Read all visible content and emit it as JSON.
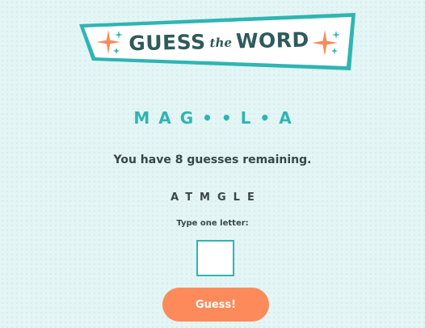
{
  "logo": {
    "word1": "GUESS",
    "word2": "the",
    "word3": "WORD"
  },
  "puzzle": {
    "display": "MAG••L•A"
  },
  "status": {
    "remaining_text": "You have 8 guesses remaining."
  },
  "guessed_letters": {
    "display": "ATMGLE"
  },
  "input": {
    "prompt": "Type one letter:",
    "value": "",
    "placeholder": ""
  },
  "guess_button": {
    "label": "Guess!"
  },
  "colors": {
    "background": "#e3f5f4",
    "accent_teal": "#2fb5b3",
    "accent_orange": "#fd8a5a",
    "text_dark": "#37474a"
  }
}
